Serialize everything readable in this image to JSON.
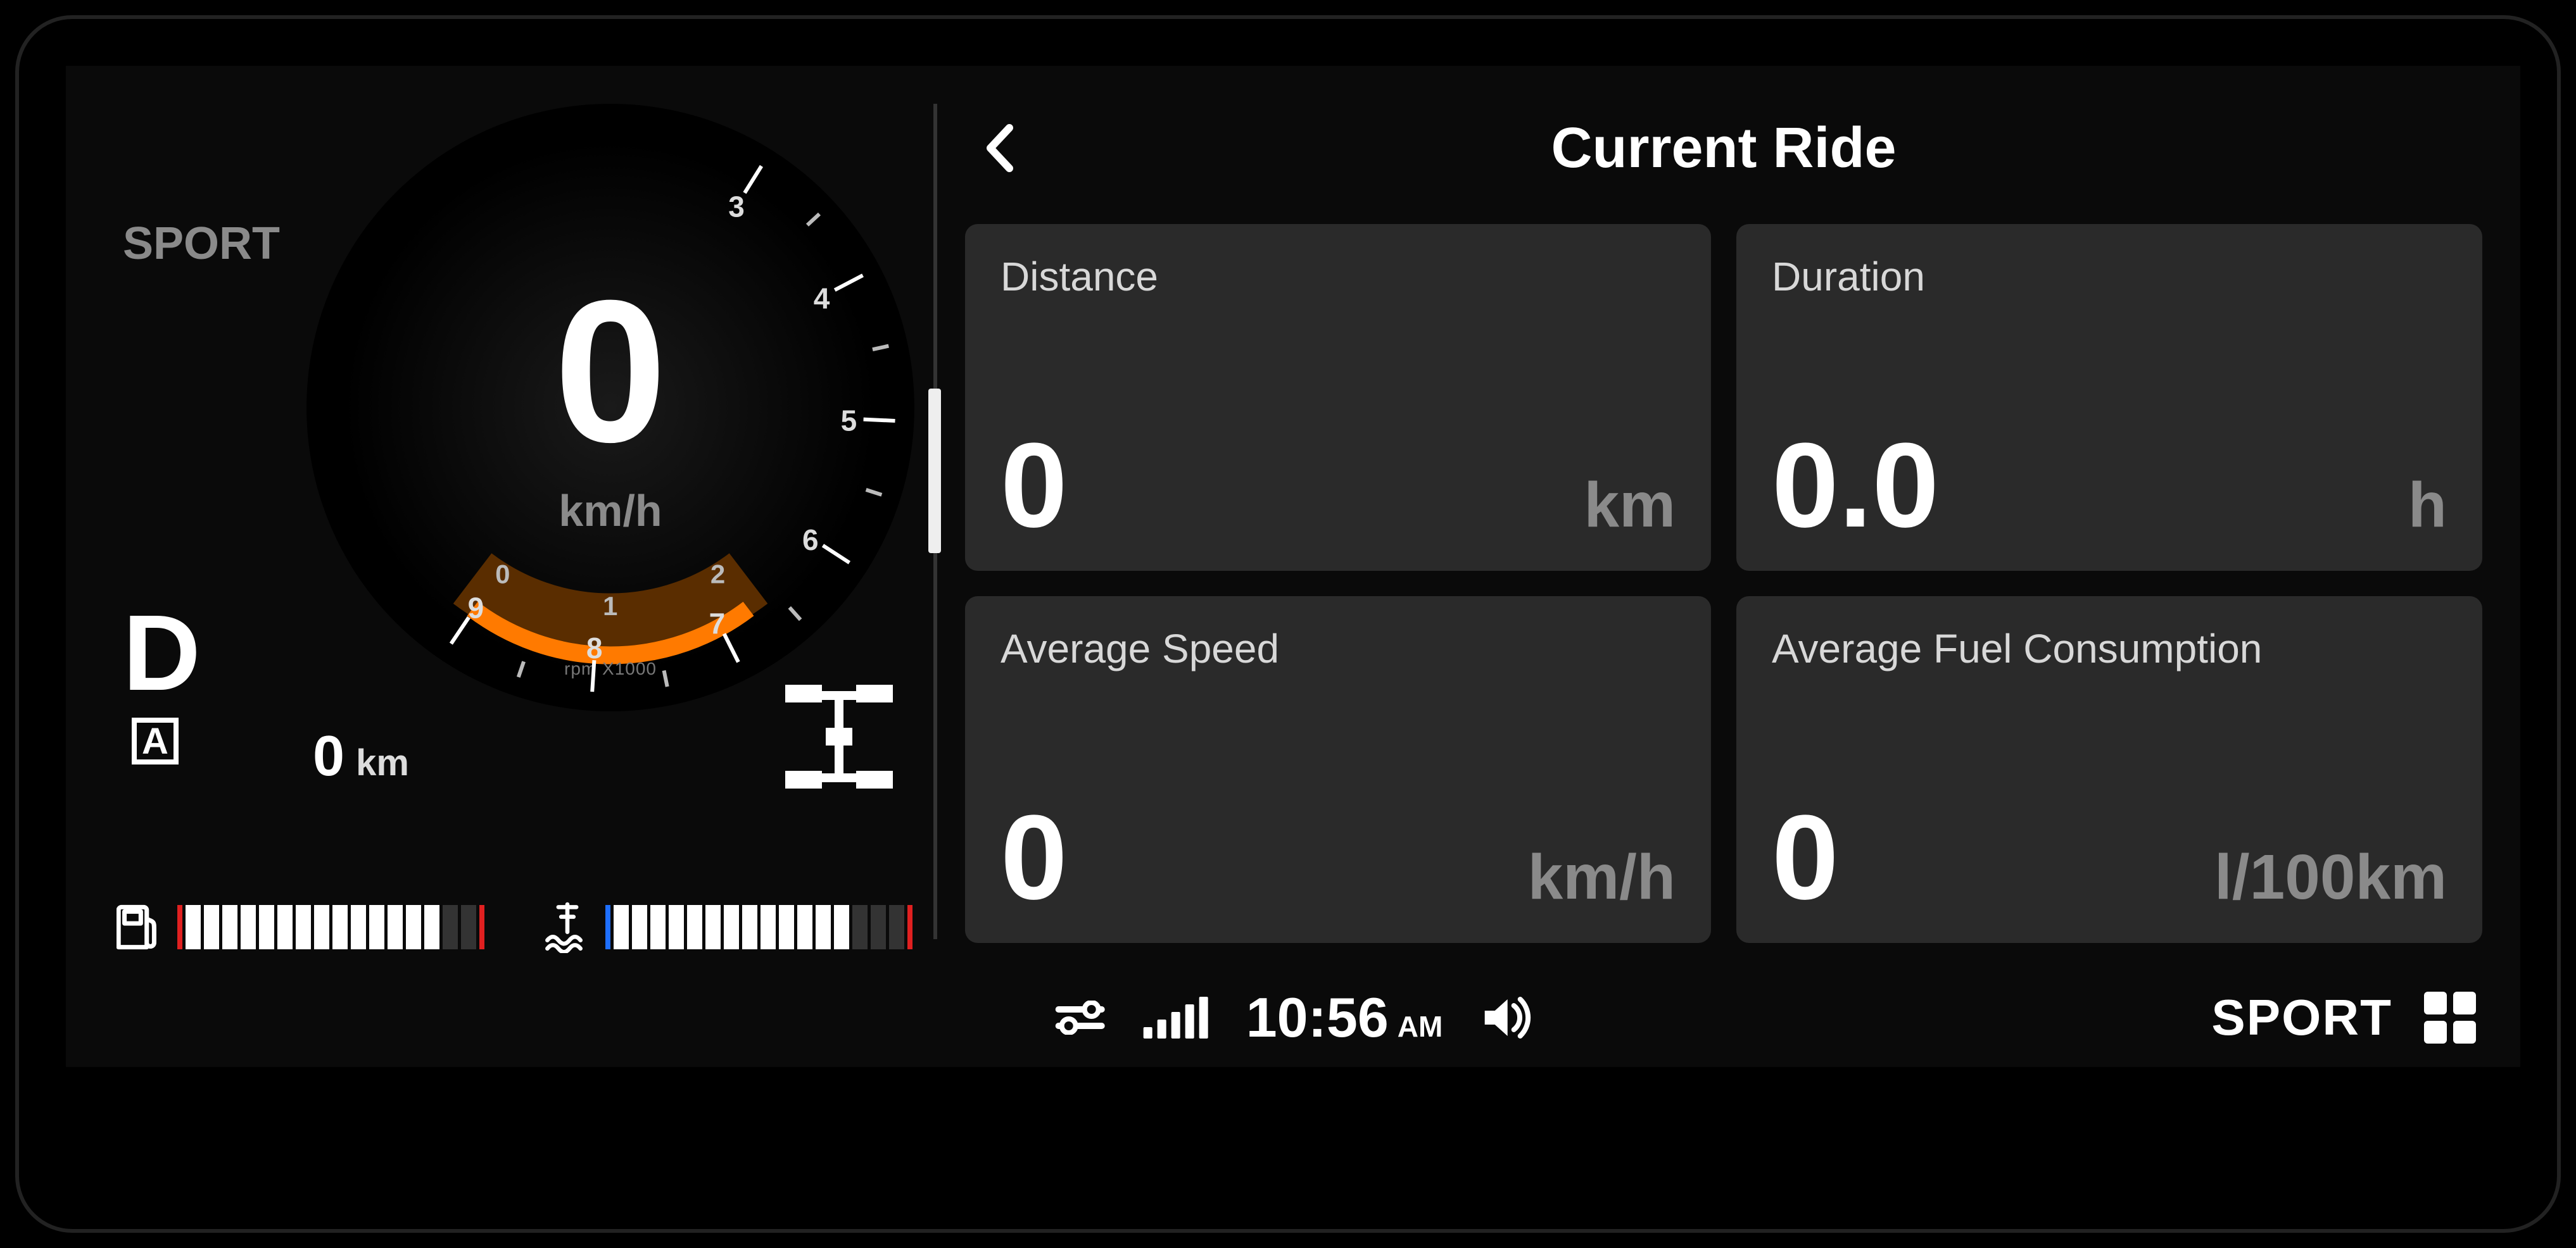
{
  "ride_mode": "SPORT",
  "gauge": {
    "speed_value": "0",
    "speed_unit": "km/h",
    "tach_numbers": [
      "3",
      "4",
      "5",
      "6",
      "7",
      "8",
      "9"
    ],
    "arc_numbers": [
      "0",
      "1",
      "2"
    ],
    "rpm_label": "rpm X1000",
    "gear": "D",
    "auto_badge": "A",
    "odometer_value": "0",
    "odometer_unit": "km"
  },
  "fuel_segments_on": 14,
  "temp_segments_on": 13,
  "segments_total": 16,
  "page": {
    "title": "Current Ride",
    "cards": [
      {
        "label": "Distance",
        "value": "0",
        "unit": "km"
      },
      {
        "label": "Duration",
        "value": "0.0",
        "unit": "h"
      },
      {
        "label": "Average Speed",
        "value": "0",
        "unit": "km/h"
      },
      {
        "label": "Average Fuel Consumption",
        "value": "0",
        "unit": "l/100km"
      }
    ]
  },
  "status": {
    "time": "10:56",
    "ampm": "AM",
    "mode": "SPORT"
  }
}
